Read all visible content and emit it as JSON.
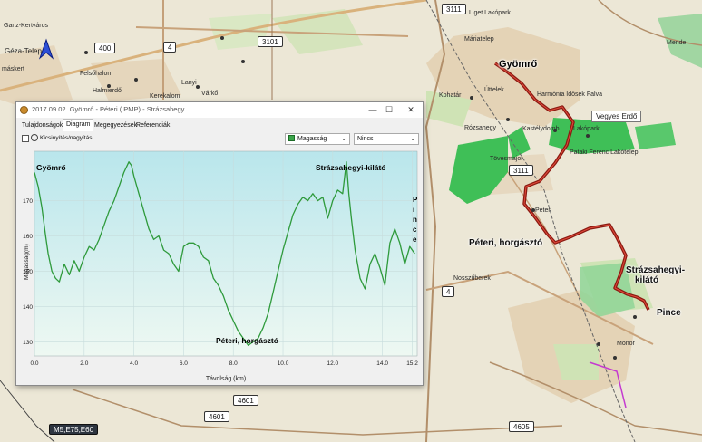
{
  "map": {
    "labels": {
      "gyomro_top": "Gyömrő",
      "ganz": "Ganz-Kertváros",
      "geza": "Géza-Telep",
      "maskert": "máskert",
      "felsohalom": "Felsőhalom",
      "halmi": "Halmierdő",
      "kerekalom": "Kerekalom",
      "lanyi": "Lanyi",
      "varko": "Várkő",
      "liget": "Liget Lakópark",
      "mariatelep": "Máriatelep",
      "uteleк": "Úttelek",
      "kohatar": "Kohatár",
      "harmonia": "Harmónia Idősek Falva",
      "veges": "Vegyes Erdő",
      "kastely": "Kastélydomb",
      "lakopark": "Lakópark",
      "rozsahegy": "Rózsahegy",
      "pataki": "Pataki Ferenc Lakótelep",
      "tovesmajor": "Tövesmajor",
      "peteri_map": "Péteri",
      "peteri_horgaszto": "Péteri, horgásztó",
      "strazsa_1": "Strázsahegyi-",
      "strazsa_2": "kilátó",
      "pince": "Pince",
      "nosszuberek": "Nosszűberek",
      "monor": "Monor",
      "mende": "Mende"
    },
    "shields": {
      "r3111_top": "3111",
      "r3101": "3101",
      "r400": "400",
      "r4_top": "4",
      "r3111_mid": "3111",
      "r4_mid": "4",
      "r4601_a": "4601",
      "r4601_b": "4601",
      "r4605": "4605",
      "m5": "M5,E75,E60"
    },
    "compass_icon": "compass-arrow-icon",
    "route_color": "#8b1a12",
    "forest_color": "#3fbf57"
  },
  "window": {
    "title": "2017.09.02. Gyömrő - Péteri ( PMP) - Strázsahegy",
    "controls": {
      "minimize": "—",
      "maximize": "☐",
      "close": "✕"
    },
    "tabs": [
      "Tulajdonságok",
      "Diagram",
      "Megegyezések",
      "Referenciák"
    ],
    "active_tab": 1,
    "zoom_label": "Kicsinyítés/nagyítás",
    "dropdown_primary": "Magasság",
    "dropdown_secondary": "Nincs",
    "dropdown_arrow": "⌄"
  },
  "chart_data": {
    "type": "line",
    "title": "",
    "xlabel": "Távolság (km)",
    "ylabel": "Magasság(m)",
    "xlim": [
      0,
      15.4
    ],
    "ylim": [
      126,
      184
    ],
    "xticks": [
      "0.0",
      "2.0",
      "4.0",
      "6.0",
      "8.0",
      "10.0",
      "12.0",
      "14.0",
      "15.2"
    ],
    "yticks": [
      "130",
      "140",
      "150",
      "160",
      "170"
    ],
    "color": "#2e9a3b",
    "annotations": {
      "start": "Gyömrő",
      "summit": "Strázsahegyi-kilátó",
      "lake": "Péteri, horgásztó",
      "end": "Pince"
    },
    "series": [
      {
        "x": [
          0,
          0.15,
          0.3,
          0.45,
          0.55,
          0.7,
          0.85,
          1.0,
          1.2,
          1.4,
          1.6,
          1.8,
          2.0,
          2.2,
          2.4,
          2.6,
          2.8,
          3.0,
          3.2,
          3.4,
          3.6,
          3.8,
          3.9,
          4.0,
          4.2,
          4.4,
          4.6,
          4.8,
          5.0,
          5.2,
          5.4,
          5.6,
          5.8,
          6.0,
          6.2,
          6.4,
          6.6,
          6.8,
          7.0,
          7.2,
          7.4,
          7.6,
          7.8,
          8.0,
          8.2,
          8.4,
          8.6,
          8.8,
          9.0,
          9.2,
          9.4,
          9.6,
          9.8,
          10.0,
          10.2,
          10.4,
          10.6,
          10.8,
          11.0,
          11.2,
          11.4,
          11.6,
          11.8,
          12.0,
          12.2,
          12.4,
          12.55,
          12.65,
          12.75,
          12.9,
          13.1,
          13.3,
          13.5,
          13.7,
          13.9,
          14.1,
          14.2,
          14.3,
          14.5,
          14.7,
          14.9,
          15.1,
          15.3
        ],
        "y": [
          178,
          174,
          168,
          160,
          155,
          150,
          148,
          147,
          152,
          149,
          153,
          150,
          154,
          157,
          156,
          159,
          163,
          167,
          170,
          174,
          178,
          181,
          180,
          177,
          172,
          167,
          162,
          159,
          160,
          156,
          155,
          152,
          150,
          157,
          158,
          158,
          157,
          154,
          153,
          148,
          146,
          143,
          139,
          136,
          133,
          131,
          129,
          130,
          131,
          134,
          138,
          144,
          150,
          156,
          161,
          166,
          169,
          171,
          170,
          172,
          170,
          171,
          165,
          170,
          173,
          172,
          181,
          172,
          165,
          156,
          148,
          145,
          152,
          155,
          151,
          146,
          152,
          158,
          162,
          158,
          152,
          157,
          155
        ]
      }
    ],
    "grid": true,
    "background": "gradient light cyan"
  }
}
